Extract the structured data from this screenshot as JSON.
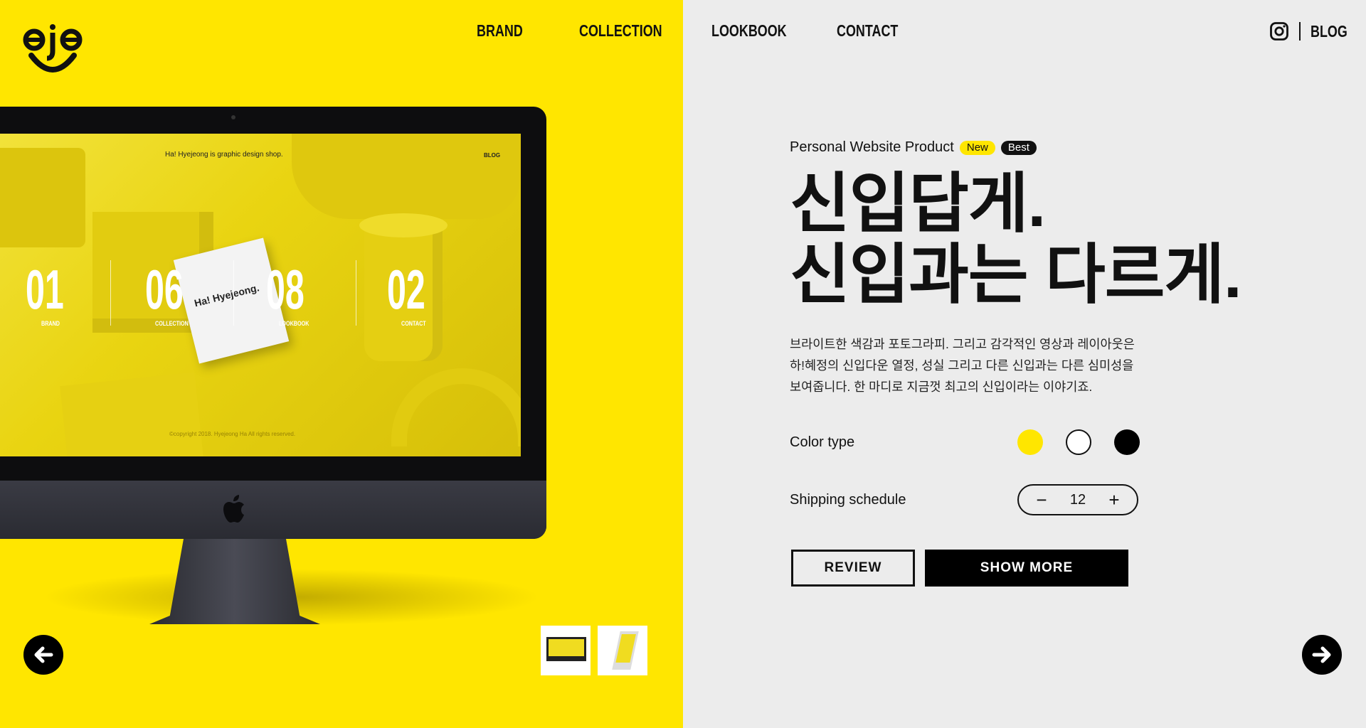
{
  "nav": {
    "items": [
      {
        "label": "BRAND"
      },
      {
        "label": "COLLECTION"
      },
      {
        "label": "LOOKBOOK"
      },
      {
        "label": "CONTACT"
      }
    ],
    "blog_label": "BLOG"
  },
  "screen": {
    "tagline": "Ha! Hyejeong is graphic design shop.",
    "blog": "BLOG",
    "card_text": "Ha! Hyejeong.",
    "copyright": "©copyright 2018. Hyejeong Ha All rights reserved.",
    "stats": [
      {
        "num": "01",
        "label": "BRAND"
      },
      {
        "num": "06",
        "label": "COLLECTION"
      },
      {
        "num": "08",
        "label": "LOOKBOOK"
      },
      {
        "num": "02",
        "label": "CONTACT"
      }
    ]
  },
  "product": {
    "eyebrow": "Personal Website Product",
    "badge_new": "New",
    "badge_best": "Best",
    "headline_1": "신입답게.",
    "headline_2": "신입과는 다르게.",
    "desc_1": "브라이트한 색감과 포토그라피. 그리고 감각적인 영상과 레이아웃은",
    "desc_2": "하!혜정의 신입다운 열정, 성실 그리고 다른 신입과는 다른 심미성을",
    "desc_3": "보여줍니다. 한 마디로 지금껏 최고의 신입이라는 이야기죠.",
    "color_label": "Color type",
    "colors": [
      "#ffe600",
      "#ffffff",
      "#000000"
    ],
    "shipping_label": "Shipping schedule",
    "shipping_value": "12",
    "minus": "−",
    "plus": "+",
    "review_label": "REVIEW",
    "more_label": "SHOW MORE"
  },
  "icons": {
    "logo": "eje-smile-logo",
    "instagram": "instagram-icon",
    "prev": "arrow-left-icon",
    "next": "arrow-right-icon"
  }
}
